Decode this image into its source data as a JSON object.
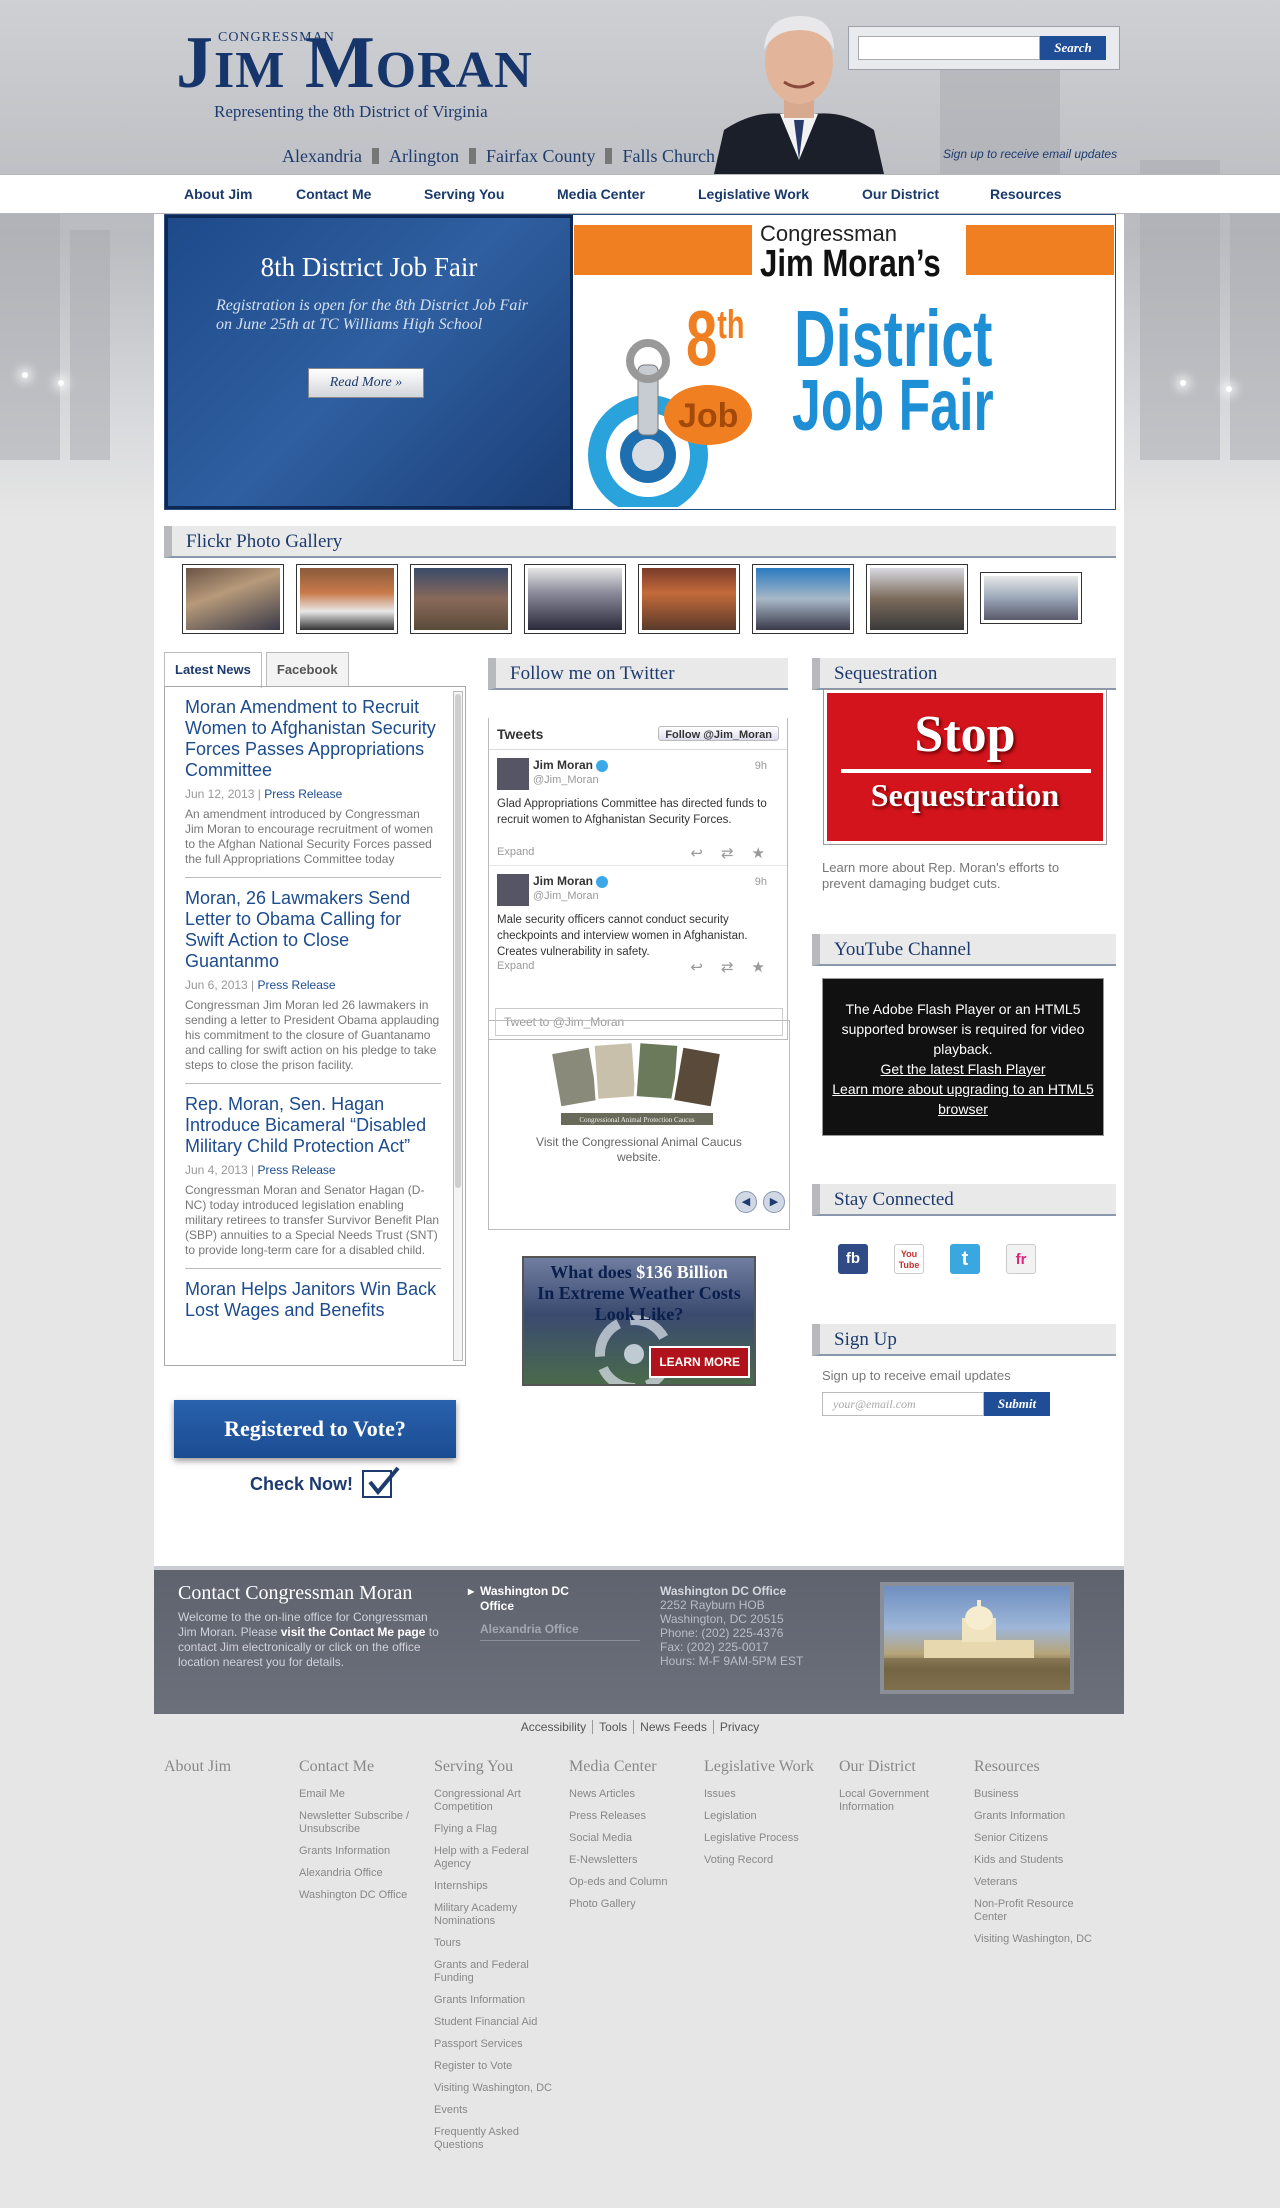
{
  "header": {
    "logo_small": "CONGRESSMAN",
    "logo_name": "Jim Moran",
    "tagline": "Representing the 8th District of Virginia",
    "towns": [
      "Alexandria",
      "Arlington",
      "Fairfax County",
      "Falls Church"
    ],
    "search_placeholder": "",
    "search_button": "Search",
    "signup_link": "Sign up to receive email updates"
  },
  "nav": [
    "About Jim",
    "Contact Me",
    "Serving You",
    "Media Center",
    "Legislative Work",
    "Our District",
    "Resources"
  ],
  "hero": {
    "title": "8th District Job Fair",
    "body": "Registration is open for the 8th District Job Fair on June 25th at TC Williams High School",
    "button": "Read More »",
    "graphic_congressman": "Congressman",
    "graphic_name": "Jim Moran’s",
    "graphic_eighth": "8",
    "graphic_th": "th",
    "graphic_district": "District",
    "graphic_jobfair": "Job Fair",
    "graphic_job": "Job"
  },
  "flickr": {
    "title": "Flickr Photo Gallery"
  },
  "news_tabs": {
    "latest": "Latest News",
    "facebook": "Facebook"
  },
  "news": [
    {
      "title": "Moran Amendment to Recruit Women to Afghanistan Security Forces Passes Appropriations Committee",
      "date": "Jun 12, 2013",
      "category": "Press Release",
      "summary": "An amendment introduced by Congressman Jim Moran to encourage recruitment of women to the Afghan National Security Forces passed the full Appropriations Committee today"
    },
    {
      "title": "Moran, 26 Lawmakers Send Letter to Obama Calling for Swift Action to Close Guantanmo",
      "date": "Jun 6, 2013",
      "category": "Press Release",
      "summary": "Congressman Jim Moran led 26 lawmakers in sending a letter to President Obama applauding his commitment to the closure of Guantanamo and calling for swift action on his pledge to take steps to close the prison facility."
    },
    {
      "title": "Rep. Moran, Sen. Hagan Introduce Bicameral “Disabled Military Child Protection Act”",
      "date": "Jun 4, 2013",
      "category": "Press Release",
      "summary": "Congressman Moran and Senator Hagan (D-NC) today introduced legislation enabling military retirees to transfer Survivor Benefit Plan (SBP) annuities to a Special Needs Trust (SNT) to provide long-term care for a disabled child."
    },
    {
      "title": "Moran Helps Janitors Win Back Lost Wages and Benefits",
      "date": "",
      "category": "",
      "summary": ""
    }
  ],
  "vote": {
    "banner": "Registered to Vote?",
    "check": "Check Now!"
  },
  "twitter": {
    "title": "Follow me on Twitter",
    "tweets_label": "Tweets",
    "follow_button": "Follow @Jim_Moran",
    "tweets": [
      {
        "name": "Jim Moran",
        "handle": "@Jim_Moran",
        "time": "9h",
        "text": "Glad Appropriations Committee has directed funds to recruit women to Afghanistan Security Forces.",
        "expand": "Expand"
      },
      {
        "name": "Jim Moran",
        "handle": "@Jim_Moran",
        "time": "9h",
        "text": "Male security officers cannot conduct security checkpoints and interview women in Afghanistan. Creates vulnerability in safety.",
        "expand": "Expand"
      }
    ],
    "compose_placeholder": "Tweet to @Jim_Moran"
  },
  "caucus": {
    "banner": "Congressional Animal Protection Caucus",
    "text": "Visit the Congressional Animal Caucus website."
  },
  "weather_ad": {
    "line1": "What does",
    "amount": "$136 Billion",
    "line2": "In Extreme Weather Costs",
    "line3": "Look Like?",
    "button": "LEARN MORE"
  },
  "sequestration": {
    "title": "Sequestration",
    "stop": "Stop",
    "sequestration_word": "Sequestration",
    "text": "Learn more about Rep. Moran's efforts to prevent damaging budget cuts."
  },
  "youtube": {
    "title": "YouTube Channel",
    "msg": "The Adobe Flash Player or an HTML5 supported browser is required for video playback.",
    "link1": "Get the latest Flash Player",
    "link2": "Learn more about upgrading to an HTML5 browser"
  },
  "stay_connected": {
    "title": "Stay Connected",
    "icons": [
      "fb",
      "You Tube",
      "t",
      "fr"
    ]
  },
  "signup": {
    "title": "Sign Up",
    "text": "Sign up to receive email updates",
    "placeholder": "your@email.com",
    "button": "Submit"
  },
  "contact": {
    "title": "Contact Congressman Moran",
    "welcome_a": "Welcome to the on-line office for Congressman Jim Moran. Please ",
    "welcome_bold": "visit the Contact Me page",
    "welcome_b": " to contact Jim electronically or click on the office location nearest you for details.",
    "office_dc": "Washington DC Office",
    "office_alex": "Alexandria Office",
    "addr_title": "Washington DC Office",
    "addr_lines": [
      "2252 Rayburn HOB",
      "Washington, DC 20515",
      "Phone: (202) 225-4376",
      "Fax: (202) 225-0017",
      "Hours: M-F 9AM-5PM EST"
    ]
  },
  "bottom_links": [
    "Accessibility",
    "Tools",
    "News Feeds",
    "Privacy"
  ],
  "sitemap": [
    {
      "title": "About Jim",
      "items": []
    },
    {
      "title": "Contact Me",
      "items": [
        "Email Me",
        "Newsletter Subscribe / Unsubscribe",
        "Grants Information",
        "Alexandria Office",
        "Washington DC Office"
      ]
    },
    {
      "title": "Serving You",
      "items": [
        "Congressional Art Competition",
        "Flying a Flag",
        "Help with a Federal Agency",
        "Internships",
        "Military Academy Nominations",
        "Tours",
        "Grants and Federal Funding",
        "Grants Information",
        "Student Financial Aid",
        "Passport Services",
        "Register to Vote",
        "Visiting Washington, DC",
        "Events",
        "Frequently Asked Questions"
      ]
    },
    {
      "title": "Media Center",
      "items": [
        "News Articles",
        "Press Releases",
        "Social Media",
        "E-Newsletters",
        "Op-eds and Column",
        "Photo Gallery"
      ]
    },
    {
      "title": "Legislative Work",
      "items": [
        "Issues",
        "Legislation",
        "Legislative Process",
        "Voting Record"
      ]
    },
    {
      "title": "Our District",
      "items": [
        "Local Government Information"
      ]
    },
    {
      "title": "Resources",
      "items": [
        "Business",
        "Grants Information",
        "Senior Citizens",
        "Kids and Students",
        "Veterans",
        "Non-Profit Resource Center",
        "Visiting Washington, DC"
      ]
    }
  ],
  "colors": {
    "brand_navy": "#16356b",
    "link_blue": "#1c4c8e",
    "orange": "#f07f22",
    "red": "#d3141c"
  }
}
